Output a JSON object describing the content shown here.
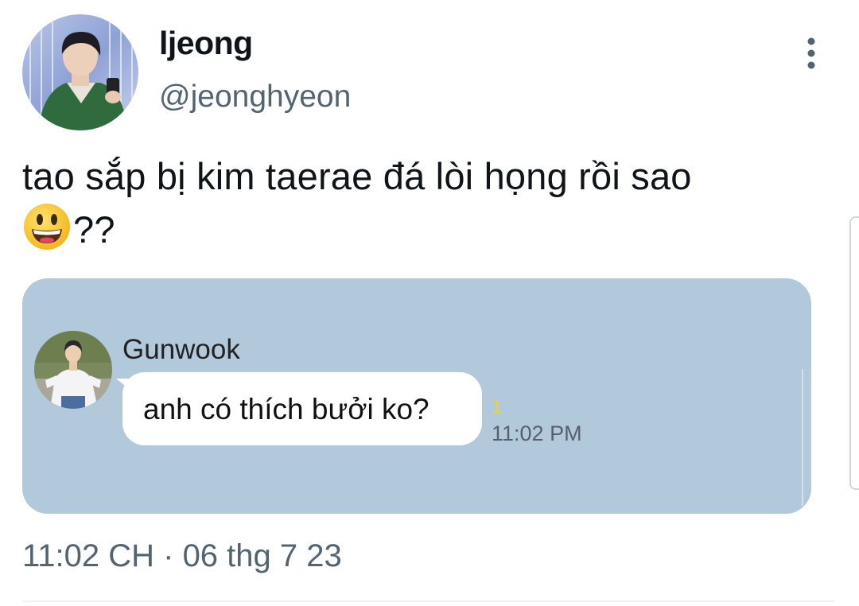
{
  "author": {
    "display_name": "ljeong",
    "handle": "@jeonghyeon",
    "avatar_icon": "profile-photo"
  },
  "tweet": {
    "text_line1": "tao sắp bị kim taerae đá lòi họng rồi sao",
    "text_line2_suffix": "??",
    "emoji": "grinning-face-emoji"
  },
  "media": {
    "background_color": "#b2c8db",
    "chat": {
      "sender_name": "Gunwook",
      "message": "anh có thích bưởi ko?",
      "unread_count": "1",
      "time": "11:02 PM"
    }
  },
  "meta": {
    "timestamp": "11:02 CH · 06 thg 7 23"
  },
  "colors": {
    "text_primary": "#0f1419",
    "text_secondary": "#536471",
    "unread_yellow": "#f0d230"
  }
}
